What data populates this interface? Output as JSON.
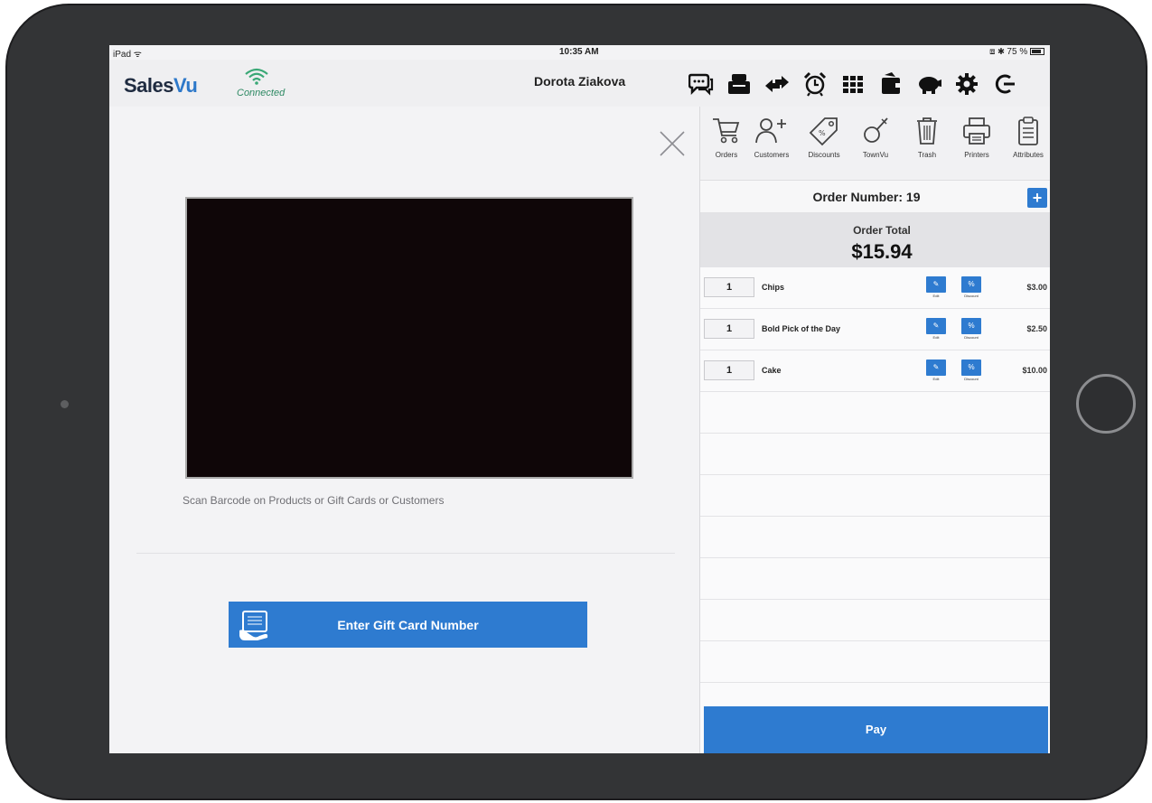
{
  "status_bar": {
    "device": "iPad",
    "time": "10:35 AM",
    "battery": "75 %"
  },
  "header": {
    "brand_main": "Sales",
    "brand_accent": "Vu",
    "connection_status": "Connected",
    "user_name": "Dorota Ziakova",
    "toolbar_icons": [
      "chat-icon",
      "cash-register-icon",
      "transfer-arrows-icon",
      "alarm-clock-icon",
      "grid-icon",
      "wallet-icon",
      "piggy-bank-icon",
      "gear-icon",
      "logout-icon"
    ]
  },
  "scanner": {
    "hint": "Scan Barcode on Products or Gift Cards or Customers",
    "gift_card_button": "Enter Gift Card Number"
  },
  "quick_bar": [
    {
      "label": "Orders",
      "icon": "cart-icon"
    },
    {
      "label": "Customers",
      "icon": "add-customer-icon"
    },
    {
      "label": "Discounts",
      "icon": "tag-icon"
    },
    {
      "label": "TownVu",
      "icon": "pin-icon"
    },
    {
      "label": "Trash",
      "icon": "trash-icon"
    },
    {
      "label": "Printers",
      "icon": "printer-icon"
    },
    {
      "label": "Attributes",
      "icon": "clipboard-icon"
    }
  ],
  "order": {
    "number_label": "Order Number: 19",
    "add_label": "+",
    "total_label": "Order Total",
    "total_value": "$15.94",
    "items": [
      {
        "qty": "1",
        "name": "Chips",
        "price": "$3.00",
        "edit": "Edit",
        "discount": "Discount"
      },
      {
        "qty": "1",
        "name": "Bold Pick of the Day",
        "price": "$2.50",
        "edit": "Edit",
        "discount": "Discount"
      },
      {
        "qty": "1",
        "name": "Cake",
        "price": "$10.00",
        "edit": "Edit",
        "discount": "Discount"
      }
    ],
    "pay_label": "Pay"
  },
  "colors": {
    "accent": "#2e7bd0",
    "brand_dark": "#1f2b40",
    "connected_green": "#2f8a64"
  }
}
